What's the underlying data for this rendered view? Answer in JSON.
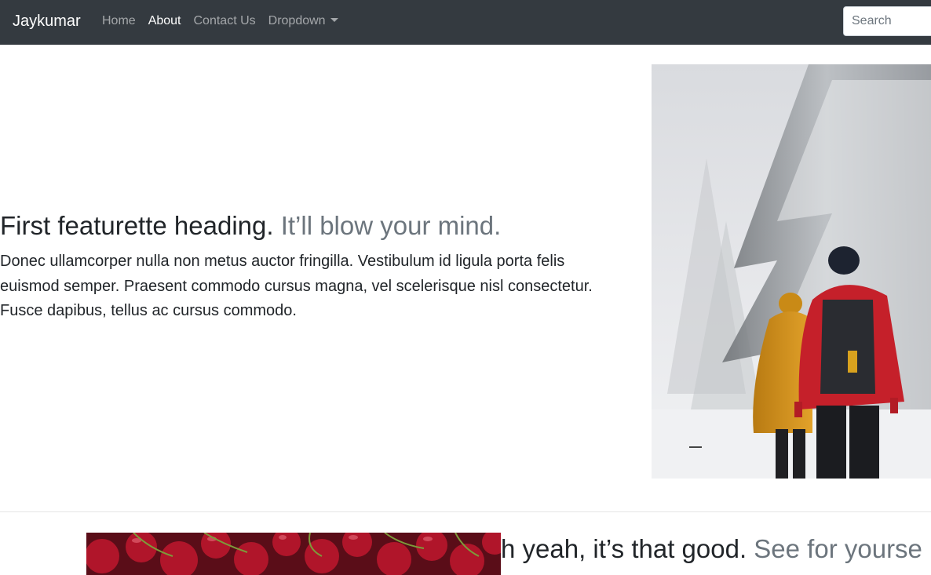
{
  "navbar": {
    "brand": "Jaykumar",
    "links": [
      {
        "label": "Home",
        "active": false
      },
      {
        "label": "About",
        "active": true
      },
      {
        "label": "Contact Us",
        "active": false
      },
      {
        "label": "Dropdown",
        "active": false
      }
    ],
    "search_placeholder": "Search"
  },
  "featurette1": {
    "heading": "First featurette heading.",
    "heading_muted": "It’ll blow your mind.",
    "lead": "Donec ullamcorper nulla non metus auctor fringilla. Vestibulum id ligula porta felis euismod semper. Praesent commodo cursus magna, vel scelerisque nisl consectetur. Fusce dapibus, tellus ac cursus commodo."
  },
  "featurette2": {
    "heading_partial": "h yeah, it’s that good.",
    "heading_muted_partial": "See for yourse"
  },
  "colors": {
    "navbar_bg": "#343a40",
    "text": "#212529",
    "muted": "#6c757d"
  }
}
